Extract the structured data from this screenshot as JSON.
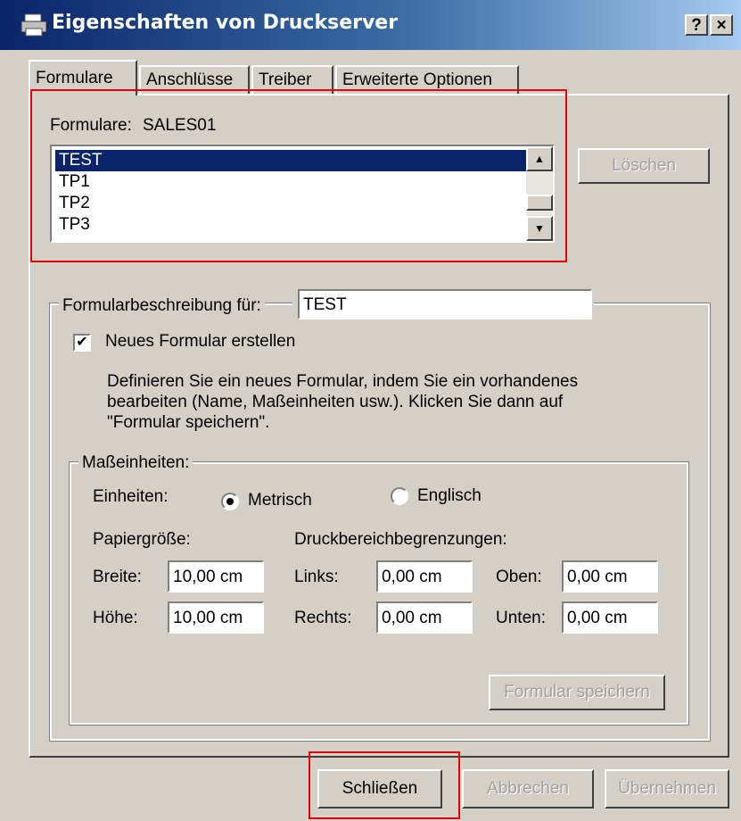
{
  "window": {
    "title": "Eigenschaften von Druckserver",
    "help_button": "?",
    "close_button": "×"
  },
  "tabs": [
    {
      "label": "Formulare",
      "active": true
    },
    {
      "label": "Anschlüsse",
      "active": false
    },
    {
      "label": "Treiber",
      "active": false
    },
    {
      "label": "Erweiterte Optionen",
      "active": false
    }
  ],
  "forms": {
    "label": "Formulare:",
    "server": "SALES01",
    "items": [
      "TEST",
      "TP1",
      "TP2",
      "TP3"
    ],
    "selected": "TEST",
    "delete_button": "Löschen"
  },
  "description": {
    "label": "Formularbeschreibung für:",
    "value": "TEST",
    "create_new_label": "Neues Formular erstellen",
    "create_new_checked": true,
    "help_text": [
      "Definieren Sie ein neues Formular, indem Sie ein vorhandenes",
      "bearbeiten (Name, Maßeinheiten usw.). Klicken Sie dann auf",
      "\"Formular speichern\"."
    ]
  },
  "units": {
    "legend": "Maßeinheiten:",
    "units_label": "Einheiten:",
    "metric_label": "Metrisch",
    "english_label": "Englisch",
    "selected": "Metrisch",
    "paper_size_label": "Papiergröße:",
    "print_area_label": "Druckbereichbegrenzungen:",
    "width_label": "Breite:",
    "width_value": "10,00 cm",
    "height_label": "Höhe:",
    "height_value": "10,00 cm",
    "left_label": "Links:",
    "left_value": "0,00 cm",
    "right_label": "Rechts:",
    "right_value": "0,00 cm",
    "top_label": "Oben:",
    "top_value": "0,00 cm",
    "bottom_label": "Unten:",
    "bottom_value": "0,00 cm",
    "save_button": "Formular speichern"
  },
  "footer": {
    "close_button": "Schließen",
    "cancel_button": "Abbrechen",
    "apply_button": "Übernehmen"
  },
  "colors": {
    "title_bar": "#0a246a",
    "selection": "#0a246a",
    "highlight_box": "#e00000",
    "dialog_bg": "#d4d0c8"
  }
}
